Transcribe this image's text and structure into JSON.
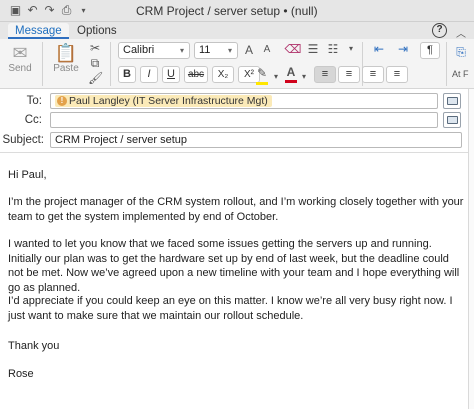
{
  "window": {
    "title": "CRM Project / server setup • (null)",
    "quick_access": [
      "save-icon",
      "undo-icon",
      "redo-icon",
      "print-icon",
      "dropdown-icon"
    ]
  },
  "tabs": [
    {
      "label": "Message",
      "active": true
    },
    {
      "label": "Options",
      "active": false
    }
  ],
  "help_label": "?",
  "ribbon": {
    "send_label": "Send",
    "paste_label": "Paste",
    "font_name": "Calibri",
    "font_size": "11",
    "bold": "B",
    "italic": "I",
    "underline": "U",
    "strike": "abc",
    "subscript": "X₂",
    "superscript": "X²",
    "grow_font": "A",
    "shrink_font": "A",
    "pilcrow": "¶",
    "overflow_label": "At F"
  },
  "colors": {
    "accent": "#2f6fbf",
    "chip_bg": "#fbeab8",
    "chip_dot": "#e3a24b",
    "highlight_bar": "#ffe600",
    "font_color_bar": "#d0021b"
  },
  "header": {
    "to_label": "To:",
    "cc_label": "Cc:",
    "subject_label": "Subject:",
    "to_recipient": "Paul Langley (IT Server Infrastructure Mgt)",
    "cc_value": "",
    "subject_value": "CRM Project / server setup"
  },
  "message": {
    "greeting": "Hi Paul,",
    "p1": "I’m the project manager of the CRM system rollout, and I’m working closely together with your team to get the system implemented by end of October.",
    "p2": "I wanted to let you know that we faced some issues getting the servers up and running. Initially our plan was to get the hardware set up  by end of last week, but the deadline could not be met. Now we’ve agreed upon a new timeline with your team and I hope everything will go as planned.",
    "p3": "I’d appreciate if you could keep an eye on this matter. I know we’re all very busy right now. I just want to make sure that we maintain our rollout schedule.",
    "closing": "Thank you",
    "signature": "Rose"
  }
}
